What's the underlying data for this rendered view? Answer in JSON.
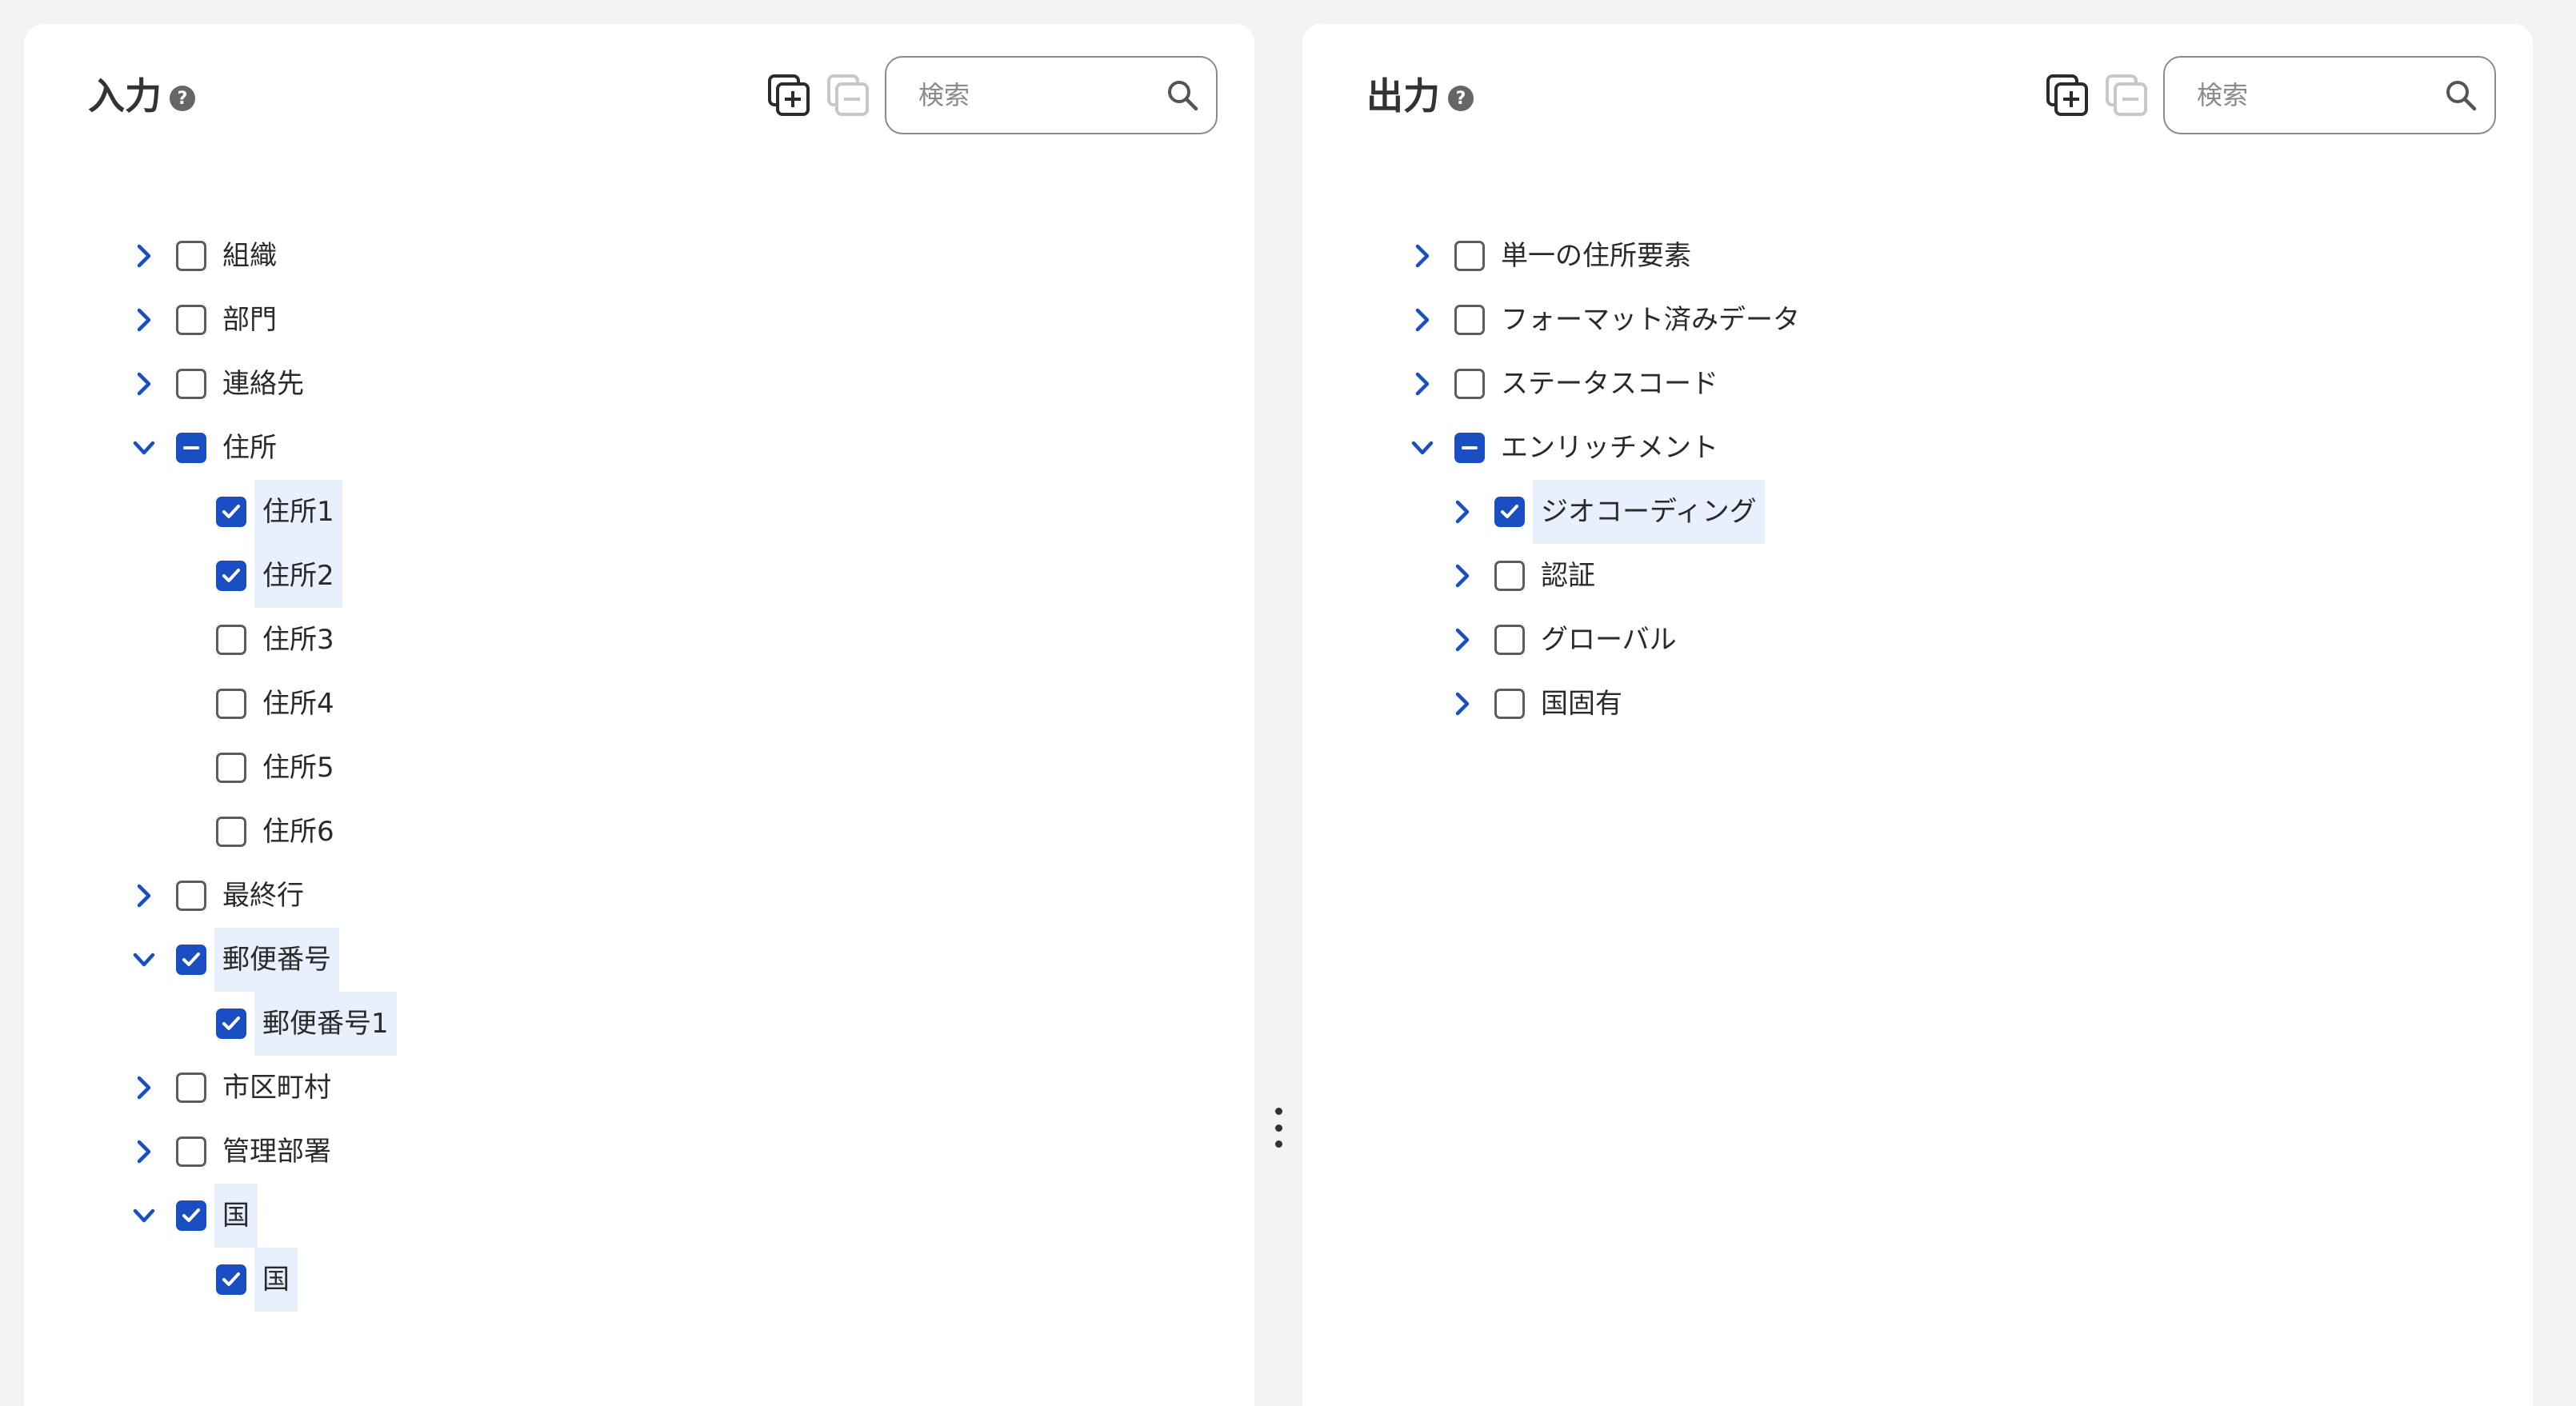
{
  "input_panel": {
    "title": "入力",
    "help_icon": "?",
    "search": {
      "placeholder": "検索",
      "value": ""
    },
    "icons": {
      "expand_all": "expand-all-icon",
      "collapse_all": "collapse-all-icon"
    },
    "items": [
      {
        "label": "組織",
        "level": 0,
        "expander": "collapsed",
        "state": "unchecked",
        "selected": false
      },
      {
        "label": "部門",
        "level": 0,
        "expander": "collapsed",
        "state": "unchecked",
        "selected": false
      },
      {
        "label": "連絡先",
        "level": 0,
        "expander": "collapsed",
        "state": "unchecked",
        "selected": false
      },
      {
        "label": "住所",
        "level": 0,
        "expander": "expanded",
        "state": "partial",
        "selected": false
      },
      {
        "label": "住所1",
        "level": 1,
        "expander": "none",
        "state": "checked",
        "selected": true
      },
      {
        "label": "住所2",
        "level": 1,
        "expander": "none",
        "state": "checked",
        "selected": true
      },
      {
        "label": "住所3",
        "level": 1,
        "expander": "none",
        "state": "unchecked",
        "selected": false
      },
      {
        "label": "住所4",
        "level": 1,
        "expander": "none",
        "state": "unchecked",
        "selected": false
      },
      {
        "label": "住所5",
        "level": 1,
        "expander": "none",
        "state": "unchecked",
        "selected": false
      },
      {
        "label": "住所6",
        "level": 1,
        "expander": "none",
        "state": "unchecked",
        "selected": false
      },
      {
        "label": "最終行",
        "level": 0,
        "expander": "collapsed",
        "state": "unchecked",
        "selected": false
      },
      {
        "label": "郵便番号",
        "level": 0,
        "expander": "expanded",
        "state": "checked",
        "selected": true
      },
      {
        "label": "郵便番号1",
        "level": 1,
        "expander": "none",
        "state": "checked",
        "selected": true
      },
      {
        "label": "市区町村",
        "level": 0,
        "expander": "collapsed",
        "state": "unchecked",
        "selected": false
      },
      {
        "label": "管理部署",
        "level": 0,
        "expander": "collapsed",
        "state": "unchecked",
        "selected": false
      },
      {
        "label": "国",
        "level": 0,
        "expander": "expanded",
        "state": "checked",
        "selected": true
      },
      {
        "label": "国",
        "level": 1,
        "expander": "none",
        "state": "checked",
        "selected": true
      }
    ]
  },
  "output_panel": {
    "title": "出力",
    "help_icon": "?",
    "search": {
      "placeholder": "検索",
      "value": ""
    },
    "icons": {
      "expand_all": "expand-all-icon",
      "collapse_all": "collapse-all-icon"
    },
    "items": [
      {
        "label": "単一の住所要素",
        "level": 0,
        "expander": "collapsed",
        "state": "unchecked",
        "selected": false
      },
      {
        "label": "フォーマット済みデータ",
        "level": 0,
        "expander": "collapsed",
        "state": "unchecked",
        "selected": false
      },
      {
        "label": "ステータスコード",
        "level": 0,
        "expander": "collapsed",
        "state": "unchecked",
        "selected": false
      },
      {
        "label": "エンリッチメント",
        "level": 0,
        "expander": "expanded",
        "state": "partial",
        "selected": false
      },
      {
        "label": "ジオコーディング",
        "level": 1,
        "expander": "collapsed",
        "state": "checked",
        "selected": true
      },
      {
        "label": "認証",
        "level": 1,
        "expander": "collapsed",
        "state": "unchecked",
        "selected": false
      },
      {
        "label": "グローバル",
        "level": 1,
        "expander": "collapsed",
        "state": "unchecked",
        "selected": false
      },
      {
        "label": "国固有",
        "level": 1,
        "expander": "collapsed",
        "state": "unchecked",
        "selected": false
      }
    ]
  },
  "splitter": {
    "icon": "vertical-dots-icon"
  },
  "colors": {
    "accent": "#1a4fc4",
    "selection_bg": "#e8effd",
    "page_bg": "#f3f3f3",
    "panel_bg": "#ffffff",
    "checkbox_border": "#5c5c5c",
    "disabled_icon": "#c8c8c8"
  }
}
